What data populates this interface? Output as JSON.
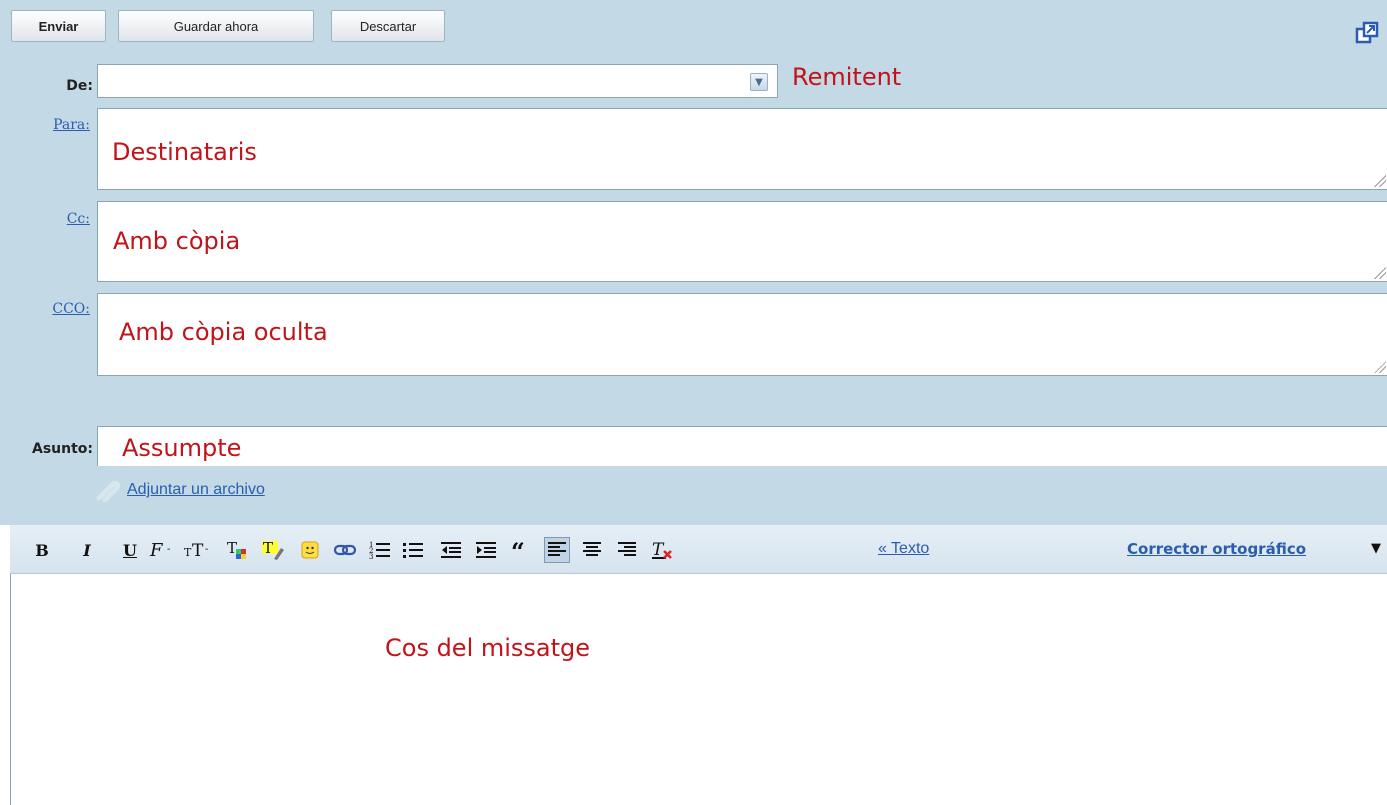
{
  "buttons": {
    "send": "Enviar",
    "save_now": "Guardar ahora",
    "discard": "Descartar"
  },
  "fields": {
    "from_label": "De:",
    "to_label": "Para:",
    "cc_label": "Cc:",
    "bcc_label": "CCO:",
    "subject_label": "Asunto:"
  },
  "annotations": {
    "from": "Remitent",
    "to": "Destinataris",
    "cc": "Amb còpia",
    "bcc": "Amb còpia oculta",
    "subject": "Assumpte",
    "body": "Cos del missatge"
  },
  "attach": {
    "label": "Adjuntar un archivo"
  },
  "toolbar": {
    "bold": "B",
    "italic": "I",
    "underline": "U",
    "plain_text_link": "« Texto",
    "spellcheck": "Corrector ortográfico",
    "spellcheck_caret": "▼",
    "icons": [
      "bold-icon",
      "italic-icon",
      "underline-icon",
      "font-icon",
      "font-size-icon",
      "text-color-icon",
      "highlight-icon",
      "emoticon-icon",
      "link-icon",
      "numbered-list-icon",
      "bullet-list-icon",
      "outdent-icon",
      "indent-icon",
      "quote-icon",
      "align-left-icon",
      "align-center-icon",
      "align-right-icon",
      "remove-formatting-icon"
    ]
  },
  "colors": {
    "panel": "#c3d9e6",
    "link": "#2a5db0",
    "annotation": "#c1141a"
  }
}
